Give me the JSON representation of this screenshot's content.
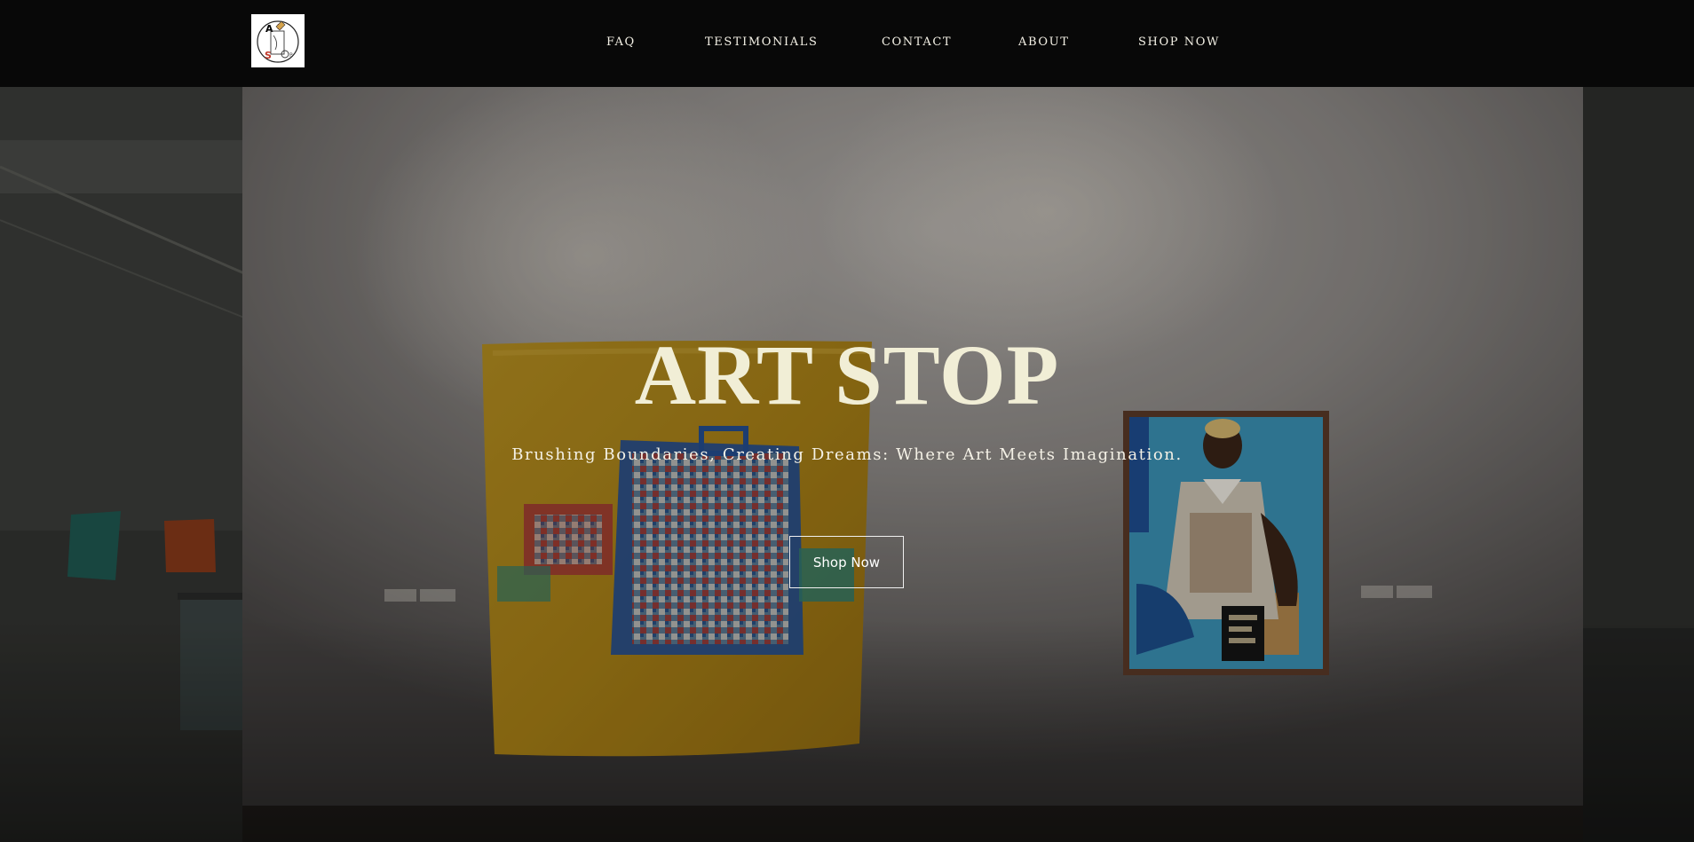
{
  "nav": {
    "logo_alt": "Art Stop logo",
    "items": [
      {
        "label": "FAQ"
      },
      {
        "label": "TESTIMONIALS"
      },
      {
        "label": "CONTACT"
      },
      {
        "label": "ABOUT"
      },
      {
        "label": "SHOP NOW"
      }
    ]
  },
  "hero": {
    "title": "ART STOP",
    "subtitle": "Brushing Boundaries, Creating Dreams: Where Art Meets Imagination.",
    "cta_label": "Shop Now"
  },
  "colors": {
    "nav_background": "#080808",
    "title": "#f1eed6",
    "text": "#f4f1e6",
    "gallery_wall": "#a29f9c",
    "quilt_yellow": "#c89b1a"
  },
  "icons": {
    "logo": "art-stop-logo-icon"
  }
}
